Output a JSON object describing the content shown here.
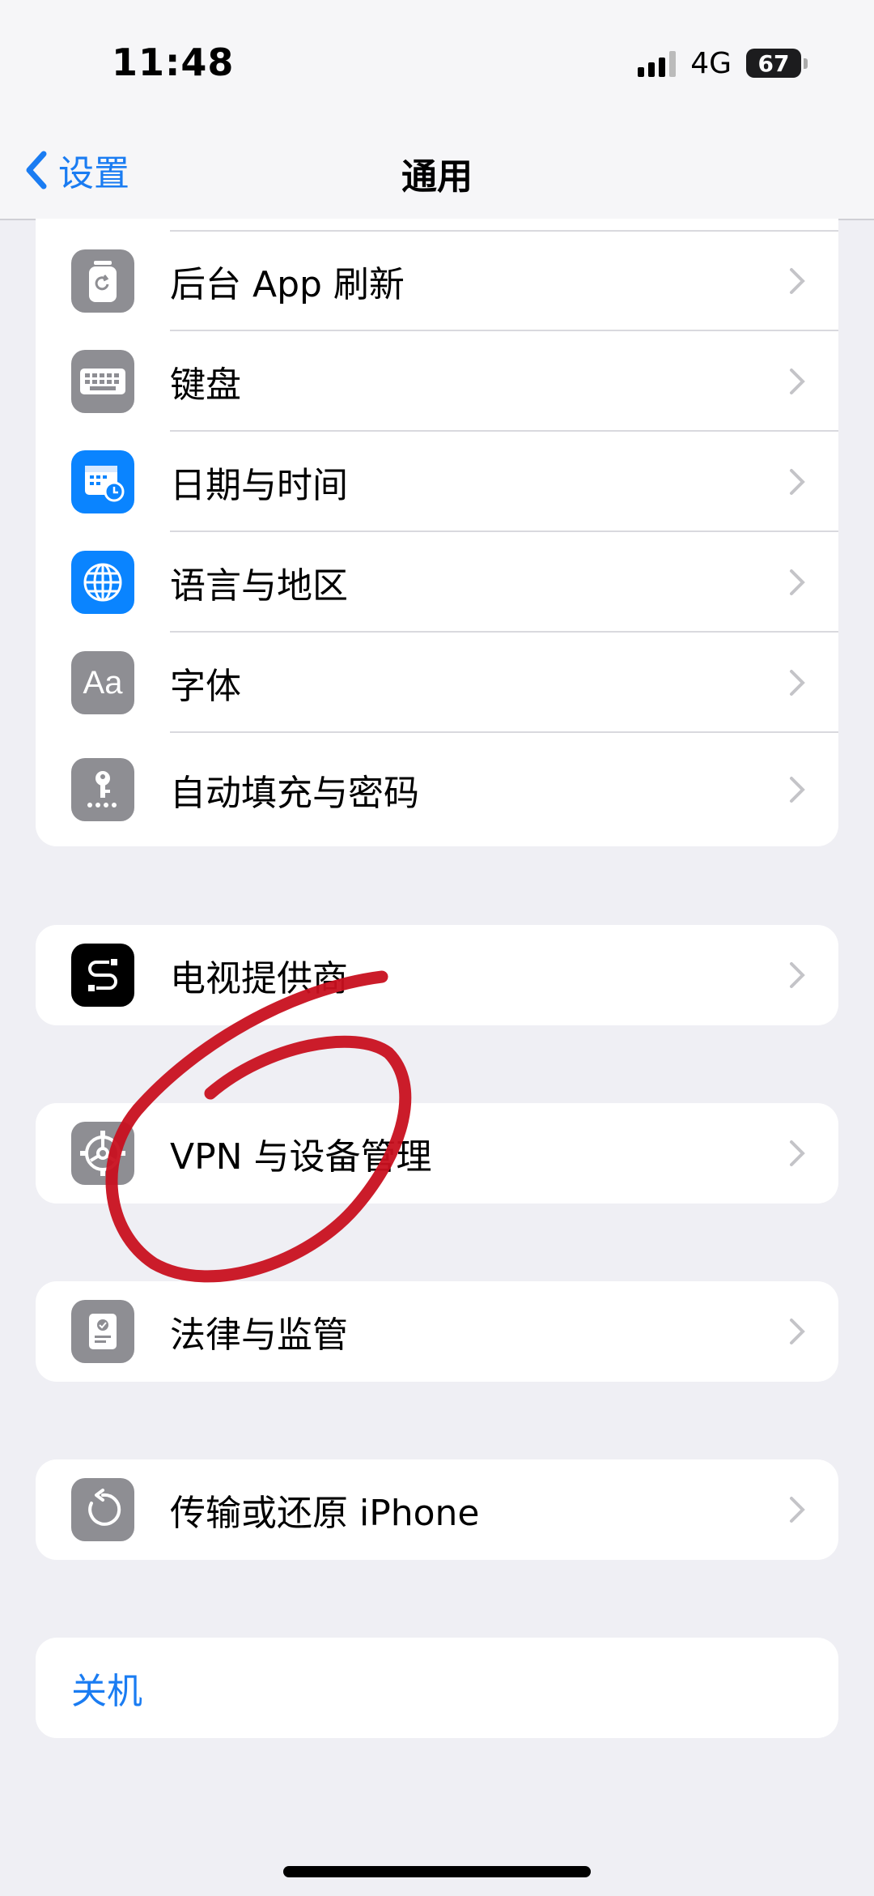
{
  "status_bar": {
    "time": "11:48",
    "network": "4G",
    "battery": "67"
  },
  "nav": {
    "back_label": "设置",
    "title": "通用"
  },
  "groups": {
    "main": [
      {
        "label": "后台 App 刷新",
        "icon": "background-refresh-icon"
      },
      {
        "label": "键盘",
        "icon": "keyboard-icon"
      },
      {
        "label": "日期与时间",
        "icon": "calendar-clock-icon"
      },
      {
        "label": "语言与地区",
        "icon": "globe-icon"
      },
      {
        "label": "字体",
        "icon": "font-icon",
        "icon_text": "Aa"
      },
      {
        "label": "自动填充与密码",
        "icon": "key-icon"
      }
    ],
    "tv": {
      "label": "电视提供商",
      "icon": "tv-provider-icon"
    },
    "vpn": {
      "label": "VPN 与设备管理",
      "icon": "gear-icon"
    },
    "legal": {
      "label": "法律与监管",
      "icon": "certificate-icon"
    },
    "transfer": {
      "label": "传输或还原 iPhone",
      "icon": "reset-icon"
    },
    "shutdown": {
      "label": "关机"
    }
  },
  "colors": {
    "accent": "#1a7cf2",
    "icon_grey": "#8e8e93",
    "icon_blue": "#0a84ff",
    "annotation": "#c8101f"
  }
}
